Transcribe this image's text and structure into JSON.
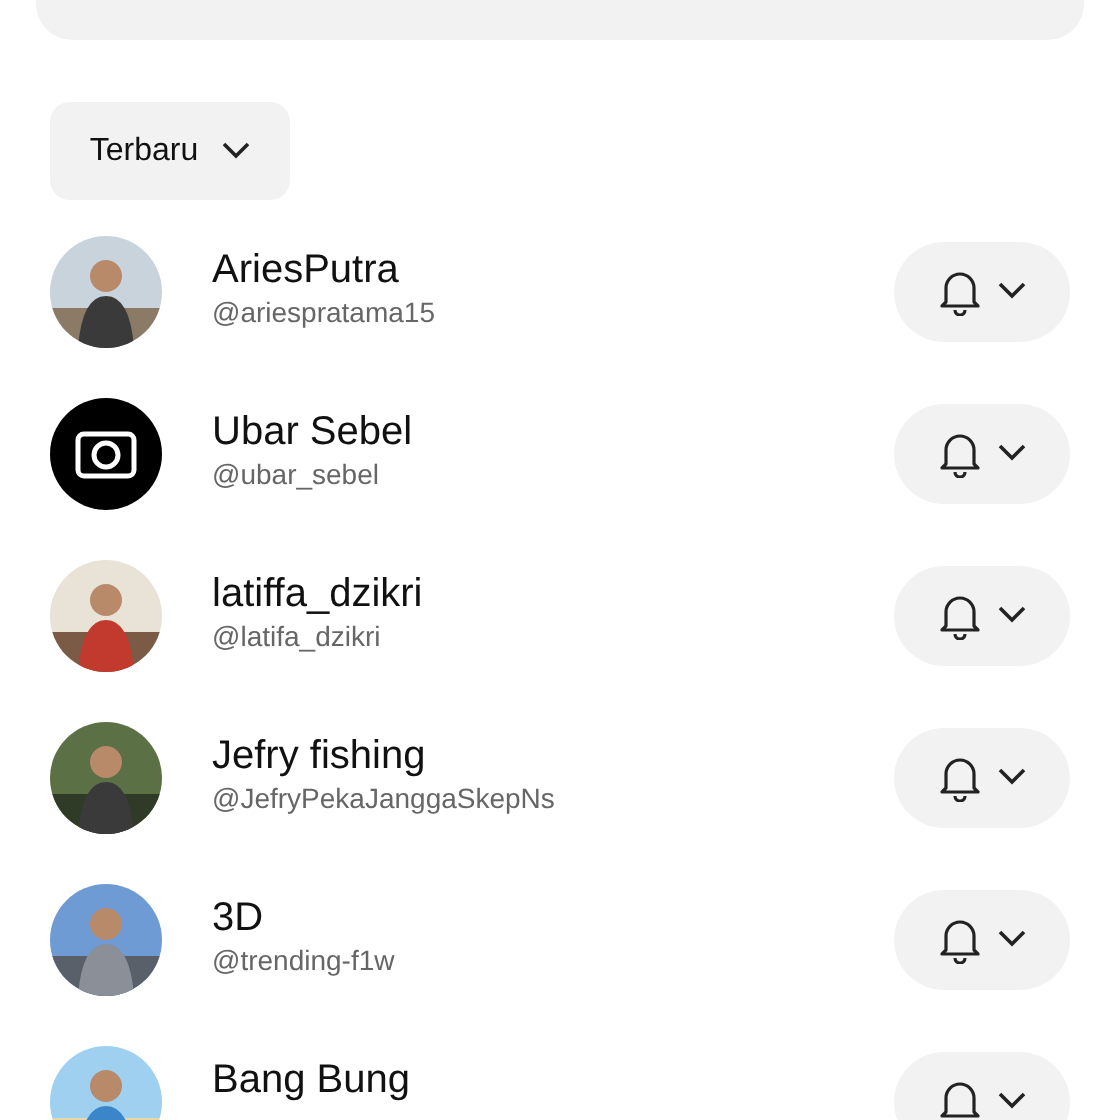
{
  "sort": {
    "label": "Terbaru"
  },
  "accounts": [
    {
      "kind": "picture",
      "name": "AriesPutra",
      "handle": "@ariespratama15"
    },
    {
      "kind": "logo",
      "name": "Ubar Sebel",
      "handle": "@ubar_sebel"
    },
    {
      "kind": "picture",
      "name": "latiffa_dzikri",
      "handle": "@latifa_dzikri"
    },
    {
      "kind": "picture",
      "name": "Jefry fishing",
      "handle": "@JefryPekaJanggaSkepNs"
    },
    {
      "kind": "picture",
      "name": "3D",
      "handle": "@trending-f1w"
    },
    {
      "kind": "picture",
      "name": "Bang Bung"
    }
  ]
}
